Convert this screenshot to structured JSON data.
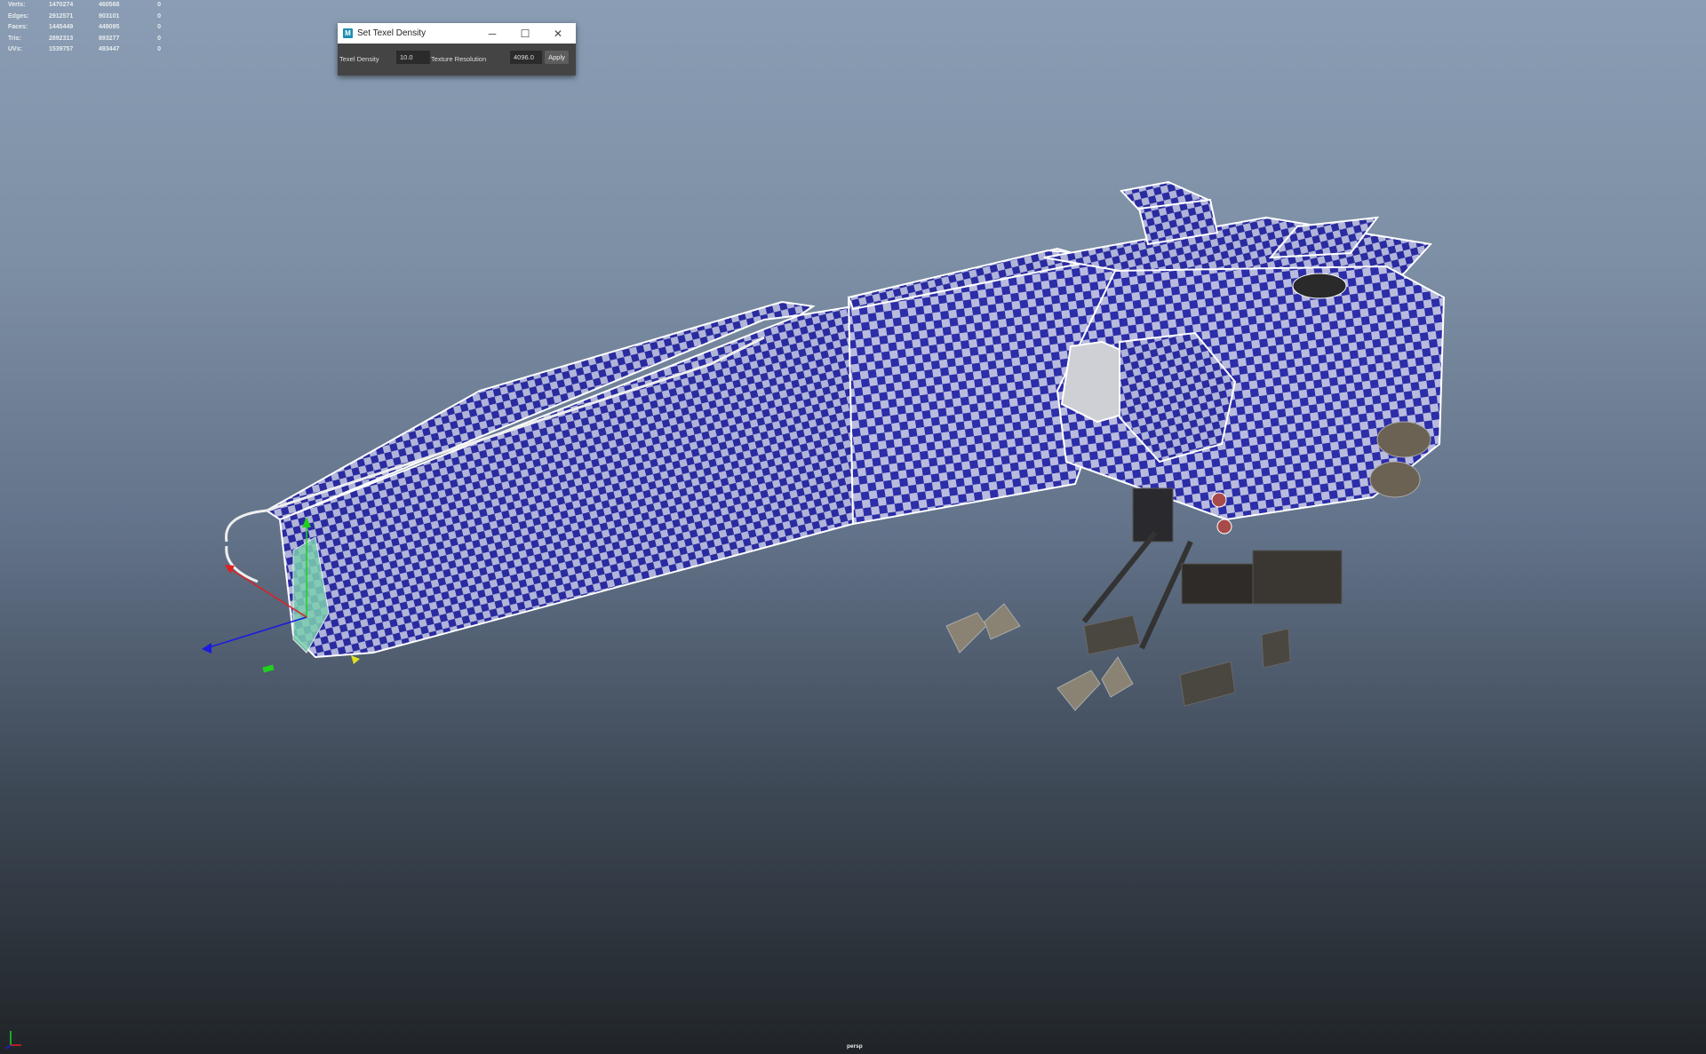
{
  "hud": {
    "rows": [
      {
        "label": "Verts:",
        "v1": "1470274",
        "v2": "460568",
        "v3": "0"
      },
      {
        "label": "Edges:",
        "v1": "2912571",
        "v2": "903101",
        "v3": "0"
      },
      {
        "label": "Faces:",
        "v1": "1445449",
        "v2": "449095",
        "v3": "0"
      },
      {
        "label": "Tris:",
        "v1": "2892313",
        "v2": "893277",
        "v3": "0"
      },
      {
        "label": "UVs:",
        "v1": "1539757",
        "v2": "493447",
        "v3": "0"
      }
    ]
  },
  "dialog": {
    "app_icon": "M",
    "title": "Set Texel Density",
    "minimize": "─",
    "maximize": "☐",
    "close": "✕",
    "texel_label": "Texel Density",
    "texel_value": "10.0",
    "resolution_label": "Texture Resolution",
    "resolution_value": "4096.0",
    "apply_label": "Apply"
  },
  "viewport": {
    "camera_label": "persp",
    "checker_color": "#2a2ba0",
    "wireframe_color": "#ffffff"
  }
}
